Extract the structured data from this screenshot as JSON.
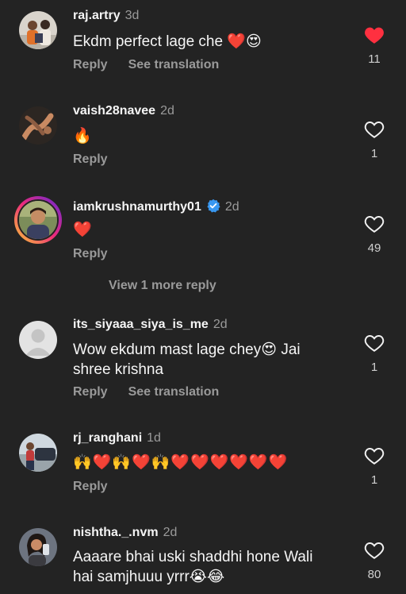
{
  "comments": [
    {
      "username": "raj.artry",
      "time": "3d",
      "text": "Ekdm perfect lage che ❤️😍",
      "reply_label": "Reply",
      "translation_label": "See translation",
      "likes": "11",
      "liked": true
    },
    {
      "username": "vaish28navee",
      "time": "2d",
      "text": "🔥",
      "reply_label": "Reply",
      "likes": "1",
      "liked": false
    },
    {
      "username": "iamkrushnamurthy01",
      "time": "2d",
      "text": "❤️",
      "reply_label": "Reply",
      "likes": "49",
      "liked": false,
      "verified": true,
      "view_more": "View 1 more reply"
    },
    {
      "username": "its_siyaaa_siya_is_me",
      "time": "2d",
      "text": "Wow  ekdum mast lage chey😍 Jai shree krishna",
      "reply_label": "Reply",
      "translation_label": "See translation",
      "likes": "1",
      "liked": false
    },
    {
      "username": "rj_ranghani",
      "time": "1d",
      "text": "🙌❤️🙌❤️🙌❤️❤️❤️❤️❤️❤️",
      "reply_label": "Reply",
      "likes": "1",
      "liked": false
    },
    {
      "username": "nishtha._.nvm",
      "time": "2d",
      "text": "Aaaare bhai uski shaddhi hone Wali hai samjhuuu yrrr😭😂",
      "likes": "80",
      "liked": false
    }
  ],
  "colors": {
    "background": "#232323",
    "liked_heart": "#ff3040",
    "verified_badge": "#3897f0",
    "muted_text": "#9a9a9a"
  },
  "icons": {
    "like": "heart-outline-icon",
    "liked": "heart-filled-icon",
    "verified": "verified-badge-icon"
  }
}
